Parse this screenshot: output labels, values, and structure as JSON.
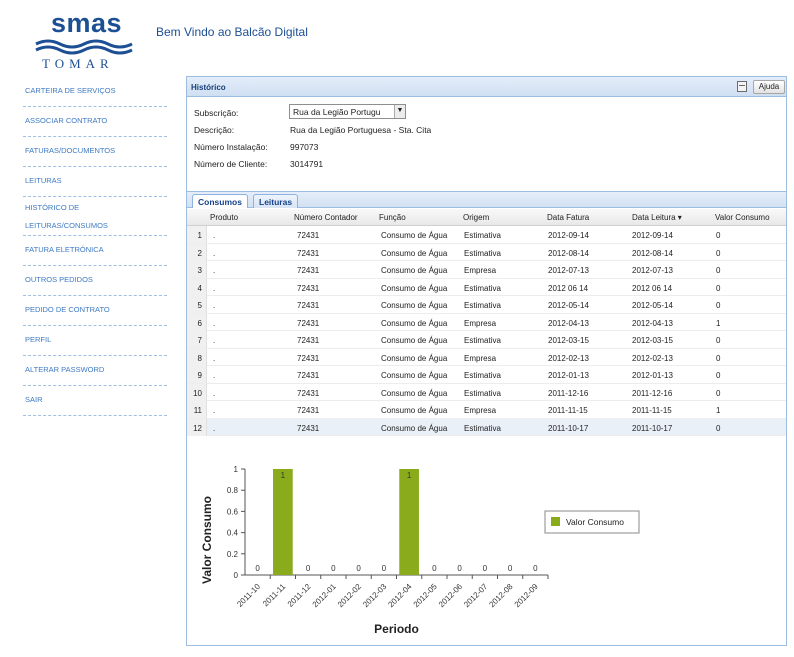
{
  "header": {
    "logo_name": "smas",
    "logo_city": "TOMAR",
    "welcome": "Bem Vindo ao Balcão Digital"
  },
  "sidebar": {
    "items": [
      {
        "label": "CARTEIRA DE SERVIÇOS"
      },
      {
        "label": "ASSOCIAR CONTRATO"
      },
      {
        "label": "FATURAS/DOCUMENTOS"
      },
      {
        "label": "LEITURAS"
      },
      {
        "label": "HISTÓRICO DE",
        "label2": "LEITURAS/CONSUMOS"
      },
      {
        "label": "FATURA ELETRÓNICA"
      },
      {
        "label": "OUTROS PEDIDOS"
      },
      {
        "label": "PEDIDO DE CONTRATO"
      },
      {
        "label": "PERFIL"
      },
      {
        "label": "ALTERAR PASSWORD"
      },
      {
        "label": "SAIR"
      }
    ]
  },
  "panel": {
    "title": "Histórico",
    "help_label": "Ajuda",
    "subscricao_label": "Subscrição:",
    "subscricao_value": "Rua da Legião Portugu",
    "descricao_label": "Descrição:",
    "descricao_value": "Rua da Legião Portuguesa - Sta. Cita",
    "instalacao_label": "Número Instalação:",
    "instalacao_value": "997073",
    "cliente_label": "Número de Cliente:",
    "cliente_value": "3014791"
  },
  "tabs": {
    "active": "Consumos",
    "inactive": "Leituras"
  },
  "grid": {
    "columns": [
      "Produto",
      "Número Contador",
      "Função",
      "Origem",
      "Data Fatura",
      "Data Leitura ▾",
      "Valor Consumo"
    ],
    "rows": [
      [
        "1",
        ".",
        "72431",
        "Consumo de Água",
        "Estimativa",
        "2012-09-14",
        "2012-09-14",
        "0"
      ],
      [
        "2",
        ".",
        "72431",
        "Consumo de Água",
        "Estimativa",
        "2012-08-14",
        "2012-08-14",
        "0"
      ],
      [
        "3",
        ".",
        "72431",
        "Consumo de Água",
        "Empresa",
        "2012-07-13",
        "2012-07-13",
        "0"
      ],
      [
        "4",
        ".",
        "72431",
        "Consumo de Água",
        "Estimativa",
        "2012 06 14",
        "2012 06 14",
        "0"
      ],
      [
        "5",
        ".",
        "72431",
        "Consumo de Água",
        "Estimativa",
        "2012-05-14",
        "2012-05-14",
        "0"
      ],
      [
        "6",
        ".",
        "72431",
        "Consumo de Água",
        "Empresa",
        "2012-04-13",
        "2012-04-13",
        "1"
      ],
      [
        "7",
        ".",
        "72431",
        "Consumo de Água",
        "Estimativa",
        "2012-03-15",
        "2012-03-15",
        "0"
      ],
      [
        "8",
        ".",
        "72431",
        "Consumo de Água",
        "Empresa",
        "2012-02-13",
        "2012-02-13",
        "0"
      ],
      [
        "9",
        ".",
        "72431",
        "Consumo de Água",
        "Estimativa",
        "2012-01-13",
        "2012-01-13",
        "0"
      ],
      [
        "10",
        ".",
        "72431",
        "Consumo de Água",
        "Estimativa",
        "2011-12-16",
        "2011-12-16",
        "0"
      ],
      [
        "11",
        ".",
        "72431",
        "Consumo de Água",
        "Empresa",
        "2011-11-15",
        "2011-11-15",
        "1"
      ],
      [
        "12",
        ".",
        "72431",
        "Consumo de Água",
        "Estimativa",
        "2011-10-17",
        "2011-10-17",
        "0"
      ]
    ]
  },
  "chart_data": {
    "type": "bar",
    "xlabel": "Periodo",
    "ylabel": "Valor Consumo",
    "categories": [
      "2011-10",
      "2011-11",
      "2011-12",
      "2012-01",
      "2012-02",
      "2012-03",
      "2012-04",
      "2012-05",
      "2012-06",
      "2012-07",
      "2012-08",
      "2012-09"
    ],
    "series": [
      {
        "name": "Valor Consumo",
        "values": [
          0,
          1,
          0,
          0,
          0,
          0,
          1,
          0,
          0,
          0,
          0,
          0
        ]
      }
    ],
    "yticks": [
      "0",
      "0.2",
      "0.4",
      "0.6",
      "0.8",
      "1"
    ],
    "ylim": [
      0,
      1
    ],
    "legend": "right",
    "bar_color": "#8aab1c"
  },
  "colors": {
    "brand": "#1c4f94",
    "link": "#3d7ac3",
    "panel_border": "#9cbde0"
  }
}
